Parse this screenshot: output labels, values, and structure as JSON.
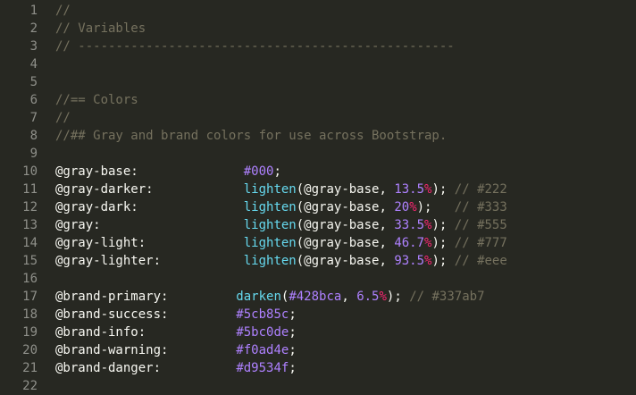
{
  "editor": {
    "language": "less",
    "theme_colors": {
      "background": "#272822",
      "gutter_text": "#8f908a",
      "comment": "#75715e",
      "default": "#f8f8f2",
      "function": "#66d9ef",
      "number": "#ae81ff",
      "percent": "#f92672"
    },
    "lines": [
      {
        "n": "1",
        "tokens": [
          {
            "t": "//",
            "c": "comment"
          }
        ]
      },
      {
        "n": "2",
        "tokens": [
          {
            "t": "// Variables",
            "c": "comment"
          }
        ]
      },
      {
        "n": "3",
        "tokens": [
          {
            "t": "// --------------------------------------------------",
            "c": "comment"
          }
        ]
      },
      {
        "n": "4",
        "tokens": []
      },
      {
        "n": "5",
        "tokens": []
      },
      {
        "n": "6",
        "tokens": [
          {
            "t": "//== Colors",
            "c": "comment"
          }
        ]
      },
      {
        "n": "7",
        "tokens": [
          {
            "t": "//",
            "c": "comment"
          }
        ]
      },
      {
        "n": "8",
        "tokens": [
          {
            "t": "//## Gray and brand colors for use across Bootstrap.",
            "c": "comment"
          }
        ]
      },
      {
        "n": "9",
        "tokens": []
      },
      {
        "n": "10",
        "tokens": [
          {
            "t": "@gray-base:",
            "c": "var"
          },
          {
            "t": "              "
          },
          {
            "t": "#000",
            "c": "color"
          },
          {
            "t": ";",
            "c": "punct"
          }
        ]
      },
      {
        "n": "11",
        "tokens": [
          {
            "t": "@gray-darker:",
            "c": "var"
          },
          {
            "t": "            "
          },
          {
            "t": "lighten",
            "c": "fn"
          },
          {
            "t": "(@gray-base, ",
            "c": "punct"
          },
          {
            "t": "13.5",
            "c": "num"
          },
          {
            "t": "%",
            "c": "pct"
          },
          {
            "t": "); ",
            "c": "punct"
          },
          {
            "t": "// #222",
            "c": "comment"
          }
        ]
      },
      {
        "n": "12",
        "tokens": [
          {
            "t": "@gray-dark:",
            "c": "var"
          },
          {
            "t": "              "
          },
          {
            "t": "lighten",
            "c": "fn"
          },
          {
            "t": "(@gray-base, ",
            "c": "punct"
          },
          {
            "t": "20",
            "c": "num"
          },
          {
            "t": "%",
            "c": "pct"
          },
          {
            "t": ");   ",
            "c": "punct"
          },
          {
            "t": "// #333",
            "c": "comment"
          }
        ]
      },
      {
        "n": "13",
        "tokens": [
          {
            "t": "@gray:",
            "c": "var"
          },
          {
            "t": "                   "
          },
          {
            "t": "lighten",
            "c": "fn"
          },
          {
            "t": "(@gray-base, ",
            "c": "punct"
          },
          {
            "t": "33.5",
            "c": "num"
          },
          {
            "t": "%",
            "c": "pct"
          },
          {
            "t": "); ",
            "c": "punct"
          },
          {
            "t": "// #555",
            "c": "comment"
          }
        ]
      },
      {
        "n": "14",
        "tokens": [
          {
            "t": "@gray-light:",
            "c": "var"
          },
          {
            "t": "             "
          },
          {
            "t": "lighten",
            "c": "fn"
          },
          {
            "t": "(@gray-base, ",
            "c": "punct"
          },
          {
            "t": "46.7",
            "c": "num"
          },
          {
            "t": "%",
            "c": "pct"
          },
          {
            "t": "); ",
            "c": "punct"
          },
          {
            "t": "// #777",
            "c": "comment"
          }
        ]
      },
      {
        "n": "15",
        "tokens": [
          {
            "t": "@gray-lighter:",
            "c": "var"
          },
          {
            "t": "           "
          },
          {
            "t": "lighten",
            "c": "fn"
          },
          {
            "t": "(@gray-base, ",
            "c": "punct"
          },
          {
            "t": "93.5",
            "c": "num"
          },
          {
            "t": "%",
            "c": "pct"
          },
          {
            "t": "); ",
            "c": "punct"
          },
          {
            "t": "// #eee",
            "c": "comment"
          }
        ]
      },
      {
        "n": "16",
        "tokens": []
      },
      {
        "n": "17",
        "tokens": [
          {
            "t": "@brand-primary:",
            "c": "var"
          },
          {
            "t": "         "
          },
          {
            "t": "darken",
            "c": "fn"
          },
          {
            "t": "(",
            "c": "punct"
          },
          {
            "t": "#428bca",
            "c": "color"
          },
          {
            "t": ", ",
            "c": "punct"
          },
          {
            "t": "6.5",
            "c": "num"
          },
          {
            "t": "%",
            "c": "pct"
          },
          {
            "t": "); ",
            "c": "punct"
          },
          {
            "t": "// #337ab7",
            "c": "comment"
          }
        ]
      },
      {
        "n": "18",
        "tokens": [
          {
            "t": "@brand-success:",
            "c": "var"
          },
          {
            "t": "         "
          },
          {
            "t": "#5cb85c",
            "c": "color"
          },
          {
            "t": ";",
            "c": "punct"
          }
        ]
      },
      {
        "n": "19",
        "tokens": [
          {
            "t": "@brand-info:",
            "c": "var"
          },
          {
            "t": "            "
          },
          {
            "t": "#5bc0de",
            "c": "color"
          },
          {
            "t": ";",
            "c": "punct"
          }
        ]
      },
      {
        "n": "20",
        "tokens": [
          {
            "t": "@brand-warning:",
            "c": "var"
          },
          {
            "t": "         "
          },
          {
            "t": "#f0ad4e",
            "c": "color"
          },
          {
            "t": ";",
            "c": "punct"
          }
        ]
      },
      {
        "n": "21",
        "tokens": [
          {
            "t": "@brand-danger:",
            "c": "var"
          },
          {
            "t": "          "
          },
          {
            "t": "#d9534f",
            "c": "color"
          },
          {
            "t": ";",
            "c": "punct"
          }
        ]
      },
      {
        "n": "22",
        "tokens": []
      }
    ]
  }
}
